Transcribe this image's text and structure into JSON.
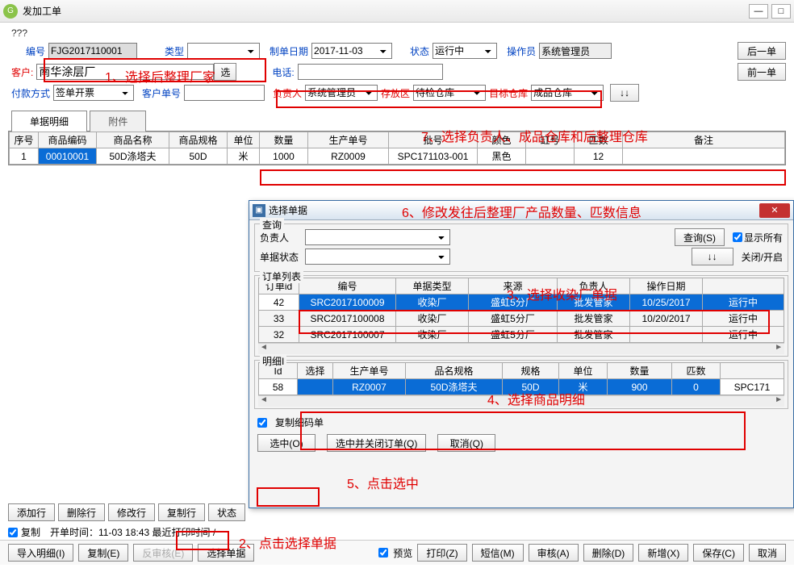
{
  "window": {
    "title": "发加工单",
    "min": "—",
    "max": "□",
    "close": "×"
  },
  "subtitle": "???",
  "header": {
    "no_label": "编号",
    "no": "FJG2017110001",
    "type_label": "类型",
    "type": "",
    "date_label": "制单日期",
    "date": "2017-11-03",
    "status_label": "状态",
    "status": "运行中",
    "operator_label": "操作员",
    "operator": "系统管理员",
    "nav_next": "后一单",
    "nav_prev": "前一单",
    "customer_label": "客户:",
    "customer": "南华涂层厂",
    "sel_btn": "选",
    "phone_label": "电话:",
    "phone": "",
    "pay_label": "付款方式",
    "pay": "签单开票",
    "cust_no_label": "客户单号",
    "cust_no": "",
    "resp_label": "负责人",
    "resp": "系统管理员",
    "store_label": "存放区",
    "store": "待检仓库",
    "target_label": "目标仓库",
    "target": "成品仓库",
    "sort_btn": "↓↓"
  },
  "tabs": {
    "t1": "单据明细",
    "t2": "附件"
  },
  "main_grid": {
    "cols": [
      "序号",
      "商品编码",
      "商品名称",
      "商品规格",
      "单位",
      "数量",
      "生产单号",
      "批号",
      "颜色",
      "缸号",
      "匹数",
      "备注"
    ],
    "row": [
      "1",
      "00010001",
      "50D涤塔夫",
      "50D",
      "米",
      "1000",
      "RZ0009",
      "SPC171103-001",
      "黑色",
      "",
      "12",
      ""
    ]
  },
  "dialog": {
    "title": "选择单据",
    "q_legend": "查询",
    "resp_label": "负责人",
    "status_label": "单据状态",
    "query_btn": "查询(S)",
    "show_all": "显示所有",
    "toggle": "关闭/开启",
    "list_legend": "订单列表",
    "order_cols": [
      "订单id",
      "编号",
      "单据类型",
      "来源",
      "负责人",
      "操作日期",
      ""
    ],
    "orders": [
      {
        "id": "42",
        "no": "SRC2017100009",
        "type": "收染厂",
        "src": "盛虹5分厂",
        "resp": "批发管家",
        "date": "10/25/2017",
        "st": "运行中",
        "sel": true
      },
      {
        "id": "33",
        "no": "SRC2017100008",
        "type": "收染厂",
        "src": "盛虹5分厂",
        "resp": "批发管家",
        "date": "10/20/2017",
        "st": "运行中",
        "sel": false
      },
      {
        "id": "32",
        "no": "SRC2017100007",
        "type": "收染厂",
        "src": "盛虹5分厂",
        "resp": "批发管家",
        "date": "",
        "st": "运行中",
        "sel": false
      }
    ],
    "detail_legend": "明细I",
    "detail_cols": [
      "Id",
      "选择",
      "生产单号",
      "品名规格",
      "规格",
      "单位",
      "数量",
      "匹数",
      ""
    ],
    "detail_row": {
      "id": "58",
      "sel": "",
      "prod": "RZ0007",
      "name": "50D涤塔夫",
      "spec": "50D",
      "unit": "米",
      "qty": "900",
      "pi": "0",
      "ext": "SPC171"
    },
    "copy_detail": "复制细码单",
    "btn_sel": "选中(O)",
    "btn_sel_close": "选中并关闭订单(Q)",
    "btn_cancel": "取消(Q)"
  },
  "footer": {
    "copy_chk": "复制",
    "open_time": "开单时间：11-03 18:43 最近打印时间 /",
    "add_row": "添加行",
    "del_row": "删除行",
    "mod_row": "修改行",
    "copy_row": "复制行",
    "state": "状态",
    "import": "导入明细(I)",
    "copy": "复制(E)",
    "unaudit": "反审核(E)",
    "select": "选择单据",
    "preview_chk": "预览",
    "print": "打印(Z)",
    "sms": "短信(M)",
    "audit": "审核(A)",
    "delete": "删除(D)",
    "new": "新增(X)",
    "save": "保存(C)",
    "cancel": "取消"
  },
  "annotations": {
    "a1": "1、选择后整理厂家",
    "a2": "2、点击选择单据",
    "a3": "3、选择收染厂单据",
    "a4": "4、选择商品明细",
    "a5": "5、点击选中",
    "a6": "6、修改发往后整理厂产品数量、匹数信息",
    "a7": "7、选择负责人、成品仓库和后整理仓库"
  }
}
